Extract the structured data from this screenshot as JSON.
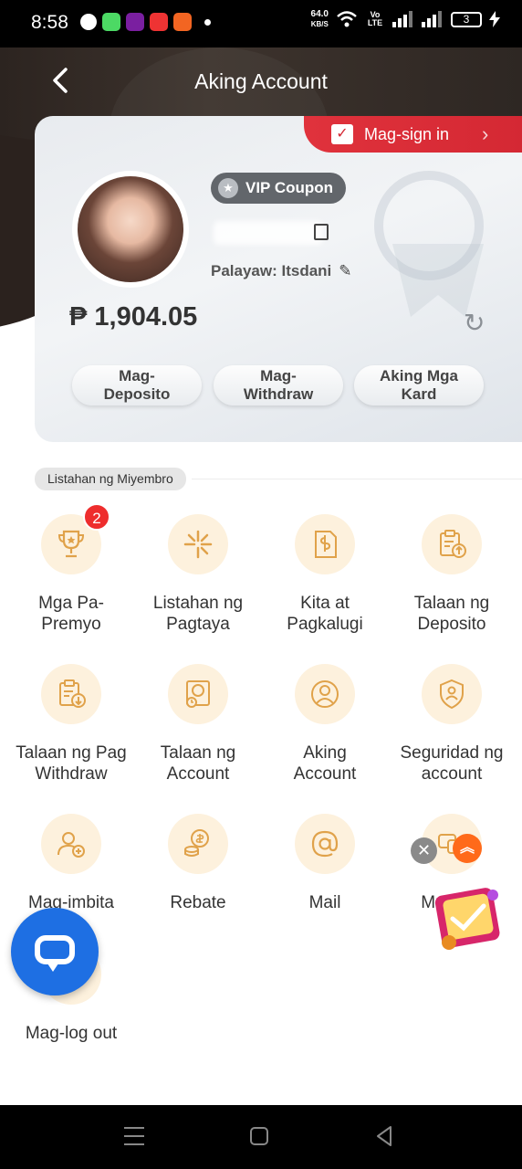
{
  "status_bar": {
    "time": "8:58",
    "net_speed_value": "64.0",
    "net_speed_unit": "KB/S",
    "volte": "Vo LTE",
    "battery": "3"
  },
  "header": {
    "title": "Aking Account"
  },
  "card": {
    "signin_label": "Mag-sign in",
    "vip_label": "VIP Coupon",
    "nickname": "Palayaw: Itsdani",
    "balance": "₱ 1,904.05",
    "buttons": [
      "Mag-Deposito",
      "Mag-Withdraw",
      "Aking Mga Kard"
    ]
  },
  "members": {
    "section_label": "Listahan ng Miyembro",
    "items": [
      {
        "label": "Mga Pa-Premyo",
        "badge": "2"
      },
      {
        "label": "Listahan ng Pagtaya"
      },
      {
        "label": "Kita at Pagkalugi"
      },
      {
        "label": "Talaan ng Deposito"
      },
      {
        "label": "Talaan ng Pag Withdraw"
      },
      {
        "label": "Talaan ng Account"
      },
      {
        "label": "Aking Account"
      },
      {
        "label": "Seguridad ng account"
      },
      {
        "label": "Mag-imbita"
      },
      {
        "label": "Rebate"
      },
      {
        "label": "Mail"
      },
      {
        "label": "Mu... ...i"
      },
      {
        "label": "Mag-log out"
      }
    ]
  },
  "colors": {
    "accent_red": "#d42833",
    "icon_bg": "#fdf1dd",
    "icon_stroke": "#e0a24a",
    "chat_blue": "#1e6fe3"
  }
}
